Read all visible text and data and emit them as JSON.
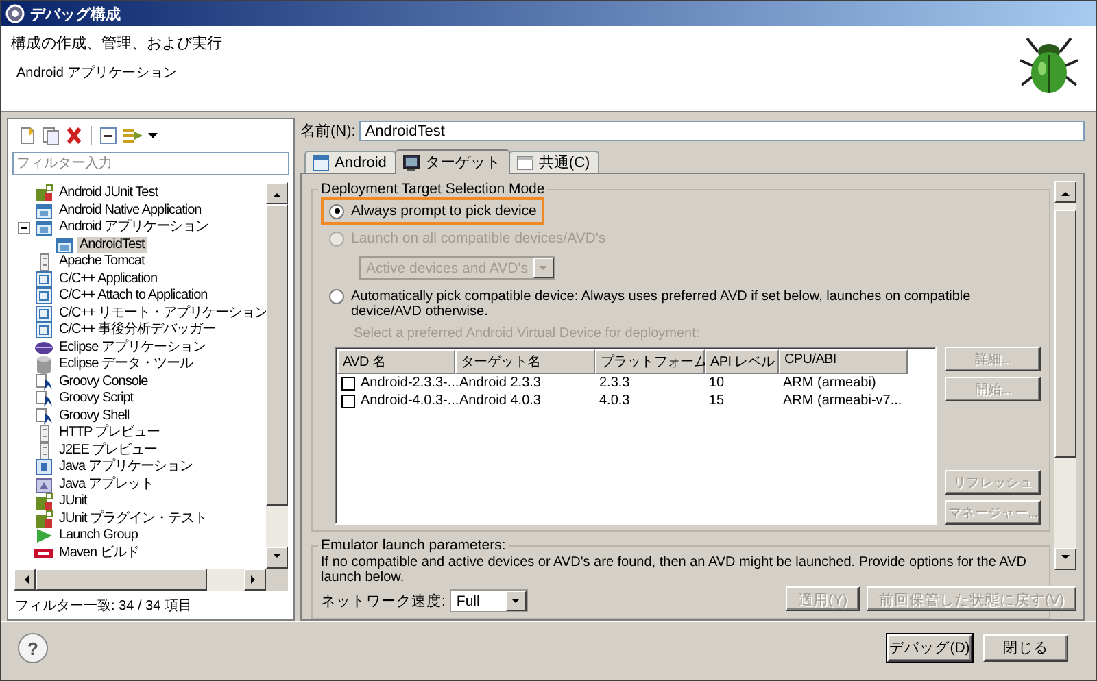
{
  "window": {
    "title": "デバッグ構成"
  },
  "header": {
    "title": "構成の作成、管理、および実行",
    "subtitle": "Android アプリケーション"
  },
  "sidebar": {
    "filter": {
      "placeholder": "フィルター入力"
    },
    "tree": [
      {
        "label": "Android JUnit Test",
        "kind": "junit",
        "selected": false
      },
      {
        "label": "Android Native Application",
        "kind": "app",
        "selected": false
      },
      {
        "label": "Android アプリケーション",
        "kind": "app",
        "selected": false,
        "expanded": true,
        "children": [
          {
            "label": "AndroidTest",
            "kind": "app",
            "selected": true
          }
        ]
      },
      {
        "label": "Apache Tomcat",
        "kind": "server",
        "selected": false
      },
      {
        "label": "C/C++ Application",
        "kind": "cpp",
        "selected": false
      },
      {
        "label": "C/C++ Attach to Application",
        "kind": "cpp",
        "selected": false
      },
      {
        "label": "C/C++ リモート・アプリケーション",
        "kind": "cpp",
        "selected": false
      },
      {
        "label": "C/C++ 事後分析デバッガー",
        "kind": "cpp",
        "selected": false
      },
      {
        "label": "Eclipse アプリケーション",
        "kind": "eclipse",
        "selected": false
      },
      {
        "label": "Eclipse データ・ツール",
        "kind": "database",
        "selected": false
      },
      {
        "label": "Groovy Console",
        "kind": "groovy",
        "selected": false
      },
      {
        "label": "Groovy Script",
        "kind": "groovy",
        "selected": false
      },
      {
        "label": "Groovy Shell",
        "kind": "groovy",
        "selected": false
      },
      {
        "label": "HTTP プレビュー",
        "kind": "server",
        "selected": false
      },
      {
        "label": "J2EE プレビュー",
        "kind": "server",
        "selected": false
      },
      {
        "label": "Java アプリケーション",
        "kind": "java",
        "selected": false
      },
      {
        "label": "Java アプレット",
        "kind": "applet",
        "selected": false
      },
      {
        "label": "JUnit",
        "kind": "junit",
        "selected": false
      },
      {
        "label": "JUnit プラグイン・テスト",
        "kind": "junit",
        "selected": false
      },
      {
        "label": "Launch Group",
        "kind": "launch",
        "selected": false
      },
      {
        "label": "Maven ビルド",
        "kind": "maven",
        "selected": false
      }
    ],
    "status": "フィルター一致: 34 / 34 項目"
  },
  "config": {
    "name_label": "名前(N):",
    "name_value": "AndroidTest",
    "tabs": [
      {
        "label": "Android",
        "selected": false
      },
      {
        "label": "ターゲット",
        "selected": true
      },
      {
        "label": "共通(C)",
        "selected": false
      }
    ],
    "target_group": {
      "title": "Deployment Target Selection Mode",
      "options": [
        {
          "label": "Always prompt to pick device",
          "selected": true,
          "disabled": false,
          "highlighted": true
        },
        {
          "label": "Launch on all compatible devices/AVD's",
          "selected": false,
          "disabled": true,
          "highlighted": false,
          "dropdown": {
            "value": "Active devices and AVD's",
            "disabled": true
          }
        },
        {
          "label": "Automatically pick compatible device: Always uses preferred AVD if set below, launches on compatible device/AVD otherwise.",
          "selected": false,
          "disabled": false,
          "highlighted": false,
          "hint": "Select a preferred Android Virtual Device for deployment:"
        }
      ]
    },
    "avd_table": {
      "columns": [
        "AVD 名",
        "ターゲット名",
        "プラットフォーム",
        "API レベル",
        "CPU/ABI"
      ],
      "rows": [
        {
          "checked": false,
          "cells": [
            "Android-2.3.3-...",
            "Android 2.3.3",
            "2.3.3",
            "10",
            "ARM (armeabi)"
          ]
        },
        {
          "checked": false,
          "cells": [
            "Android-4.0.3-...",
            "Android 4.0.3",
            "4.0.3",
            "15",
            "ARM (armeabi-v7..."
          ]
        }
      ]
    },
    "side_buttons": [
      {
        "label": "詳細...",
        "disabled": true
      },
      {
        "label": "開始...",
        "disabled": true
      },
      {
        "label": "リフレッシュ",
        "disabled": true
      },
      {
        "label": "マネージャー...",
        "disabled": true
      }
    ],
    "emulator_group": {
      "title": "Emulator launch parameters:",
      "description": "If no compatible and active devices or AVD's are found, then an AVD might be launched. Provide options for the AVD launch below.",
      "network_label": "ネットワーク速度:",
      "network_value": "Full"
    },
    "buttons": [
      {
        "label": "適用(Y)",
        "disabled": true
      },
      {
        "label": "前回保管した状態に戻す(V)",
        "disabled": true
      }
    ]
  },
  "footer": {
    "help": "?",
    "buttons": [
      {
        "label": "デバッグ(D)",
        "default": true
      },
      {
        "label": "閉じる",
        "default": false
      }
    ]
  }
}
